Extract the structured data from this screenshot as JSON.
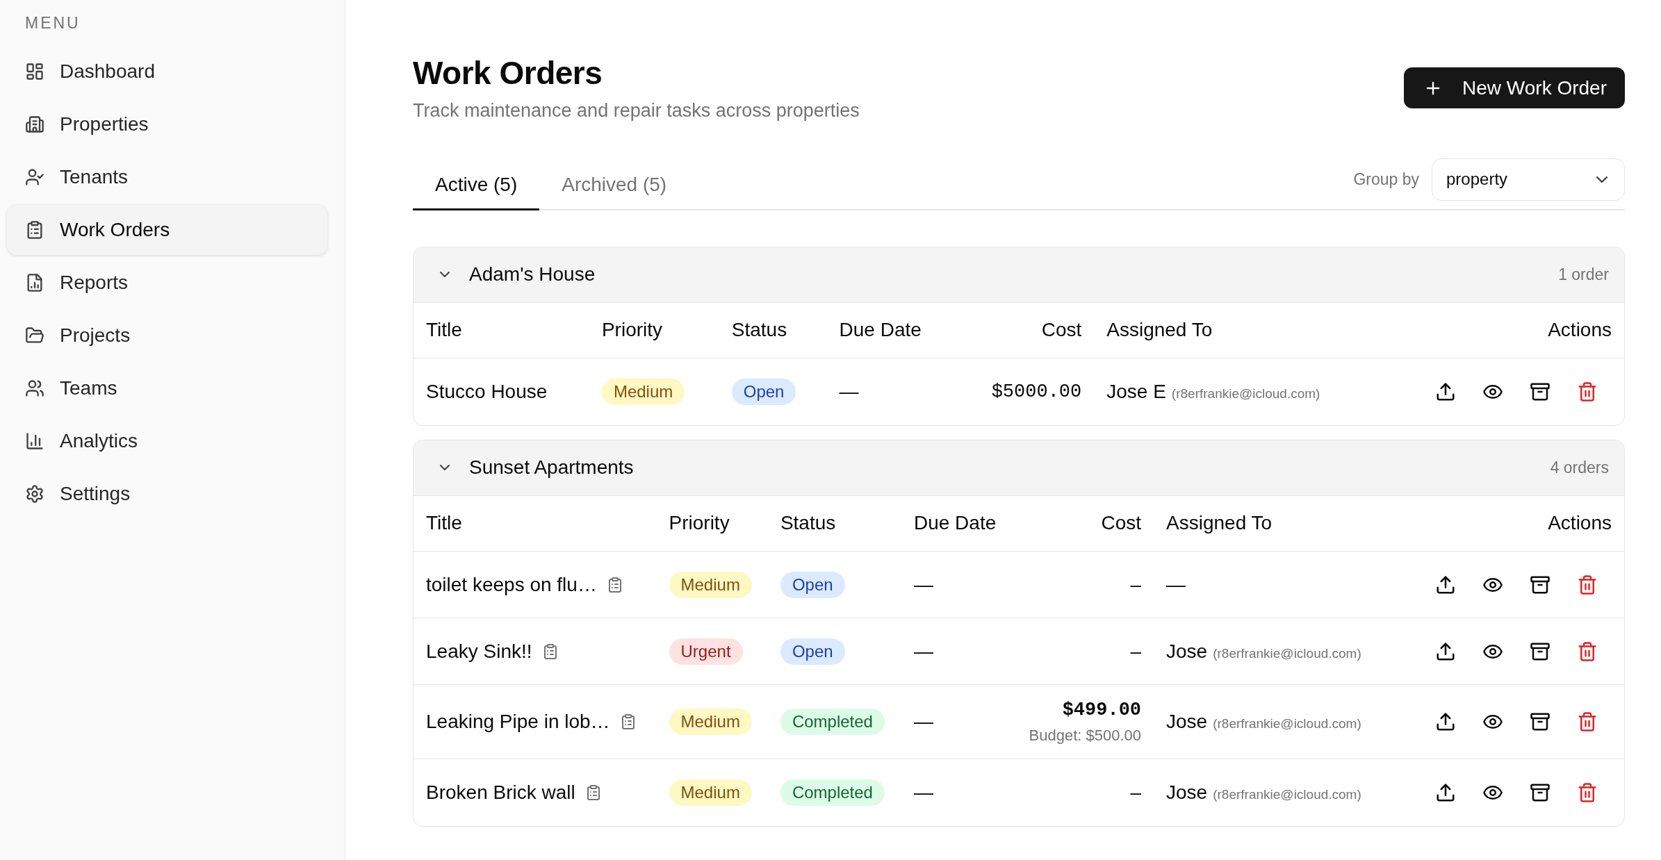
{
  "sidebar": {
    "heading": "MENU",
    "items": [
      {
        "label": "Dashboard",
        "selected": false
      },
      {
        "label": "Properties",
        "selected": false
      },
      {
        "label": "Tenants",
        "selected": false
      },
      {
        "label": "Work Orders",
        "selected": true
      },
      {
        "label": "Reports",
        "selected": false
      },
      {
        "label": "Projects",
        "selected": false
      },
      {
        "label": "Teams",
        "selected": false
      },
      {
        "label": "Analytics",
        "selected": false
      },
      {
        "label": "Settings",
        "selected": false
      }
    ]
  },
  "header": {
    "title": "Work Orders",
    "subtitle": "Track maintenance and repair tasks across properties",
    "new_button": "New Work Order"
  },
  "tabs": [
    {
      "label": "Active (5)",
      "selected": true
    },
    {
      "label": "Archived (5)",
      "selected": false
    }
  ],
  "group_by": {
    "label": "Group by",
    "value": "property"
  },
  "groups": [
    {
      "name": "Adam's House",
      "count": "1 order",
      "expanded": true,
      "columns": [
        "Title",
        "Priority",
        "Status",
        "Due Date",
        "Cost",
        "Assigned To",
        "Actions"
      ],
      "rows": [
        {
          "title": "Stucco House",
          "has_notes": false,
          "priority": {
            "label": "Medium",
            "kind": "medium"
          },
          "status": {
            "label": "Open",
            "kind": "open"
          },
          "due_date": "—",
          "cost": {
            "text": "$5000.00",
            "kind": "amount"
          },
          "assignee": {
            "name": "Jose E",
            "email": "(r8erfrankie@icloud.com)"
          }
        }
      ]
    },
    {
      "name": "Sunset Apartments",
      "count": "4 orders",
      "expanded": true,
      "columns": [
        "Title",
        "Priority",
        "Status",
        "Due Date",
        "Cost",
        "Assigned To",
        "Actions"
      ],
      "rows": [
        {
          "title": "toilet keeps on flu…",
          "has_notes": true,
          "priority": {
            "label": "Medium",
            "kind": "medium"
          },
          "status": {
            "label": "Open",
            "kind": "open"
          },
          "due_date": "—",
          "cost": {
            "text": "–",
            "kind": "none"
          },
          "assignee": {
            "name": "—"
          }
        },
        {
          "title": "Leaky Sink!!",
          "has_notes": true,
          "priority": {
            "label": "Urgent",
            "kind": "urgent"
          },
          "status": {
            "label": "Open",
            "kind": "open"
          },
          "due_date": "—",
          "cost": {
            "text": "–",
            "kind": "none"
          },
          "assignee": {
            "name": "Jose",
            "email": "(r8erfrankie@icloud.com)"
          }
        },
        {
          "title": "Leaking Pipe in lob…",
          "has_notes": true,
          "priority": {
            "label": "Medium",
            "kind": "medium"
          },
          "status": {
            "label": "Completed",
            "kind": "completed"
          },
          "due_date": "—",
          "cost": {
            "text": "$499.00",
            "kind": "actual",
            "budget": "Budget: $500.00"
          },
          "assignee": {
            "name": "Jose",
            "email": "(r8erfrankie@icloud.com)"
          }
        },
        {
          "title": "Broken Brick wall",
          "has_notes": true,
          "priority": {
            "label": "Medium",
            "kind": "medium"
          },
          "status": {
            "label": "Completed",
            "kind": "completed"
          },
          "due_date": "—",
          "cost": {
            "text": "–",
            "kind": "none"
          },
          "assignee": {
            "name": "Jose",
            "email": "(r8erfrankie@icloud.com)"
          }
        }
      ]
    }
  ]
}
